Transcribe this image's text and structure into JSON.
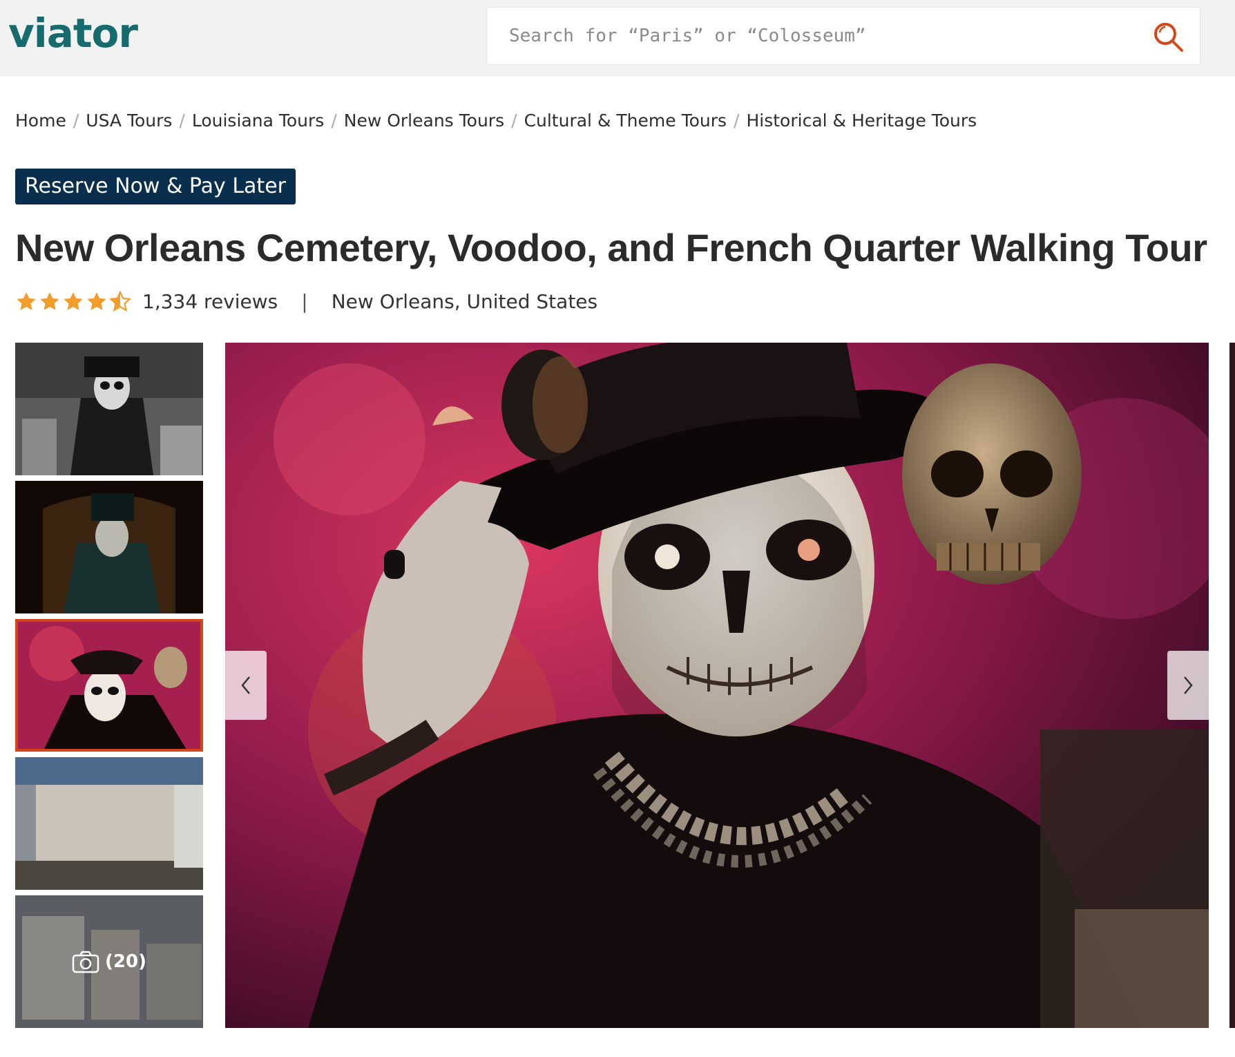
{
  "header": {
    "logo": "viator",
    "search_placeholder": "Search for “Paris” or “Colosseum”"
  },
  "breadcrumb": [
    "Home",
    "USA Tours",
    "Louisiana Tours",
    "New Orleans Tours",
    "Cultural & Theme Tours",
    "Historical & Heritage Tours"
  ],
  "breadcrumb_separator": "/",
  "badge": "Reserve Now & Pay Later",
  "title": "New Orleans Cemetery, Voodoo, and French Quarter Walking Tour",
  "rating": {
    "stars": 4.5,
    "reviews": "1,334 reviews",
    "divider": "|",
    "location": "New Orleans, United States"
  },
  "gallery": {
    "selected_index": 2,
    "photo_count": "(20)",
    "thumb_count": 5
  },
  "colors": {
    "brand": "#186b6d",
    "accent": "#e05a2a",
    "badge_bg": "#0a2e4d",
    "star": "#f29c2b",
    "selected_border": "#d2481c"
  },
  "icons": {
    "search": "search-icon",
    "prev": "chevron-left-icon",
    "next": "chevron-right-icon",
    "camera": "camera-icon",
    "star": "star-icon"
  }
}
